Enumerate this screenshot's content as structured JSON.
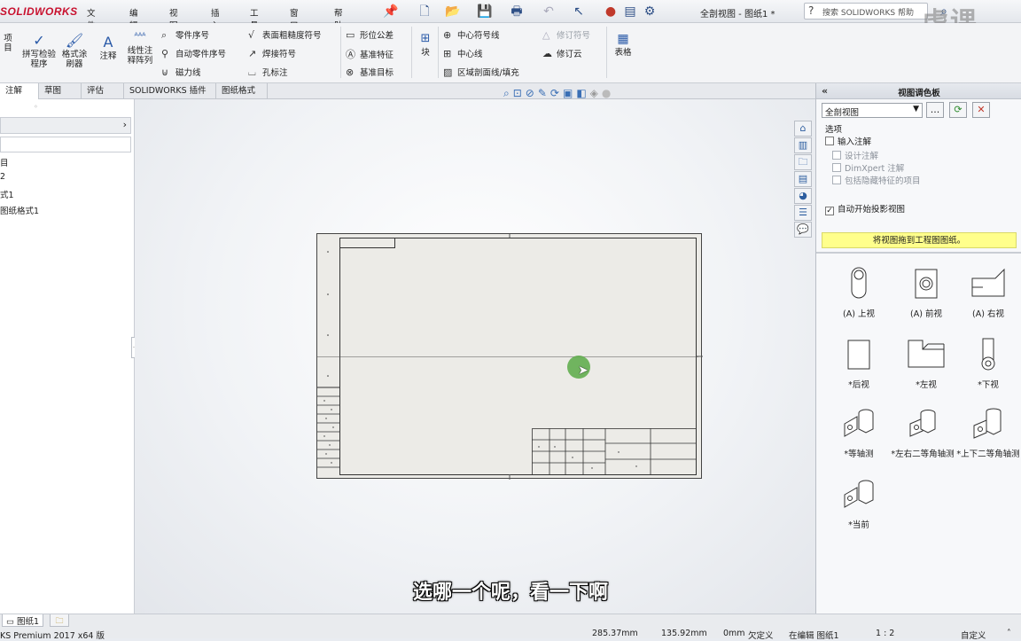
{
  "app": {
    "logo": "SOLIDWORKS",
    "menu": [
      "文件(F)",
      "编辑(E)",
      "视图(V)",
      "插入(I)",
      "工具(T)",
      "窗口(W)",
      "帮助(H)"
    ],
    "document_title": "全剖视图 - 图纸1 *",
    "search_placeholder": "搜索 SOLIDWORKS 帮助",
    "watermark": "虎课"
  },
  "ribbon": {
    "left_cut_label": "项目",
    "spellcheck": "拼写检验程序",
    "format_painter": "格式涂刷器",
    "note": "注释",
    "linear_note": "线性注释阵列",
    "balloon": "零件序号",
    "auto_balloon": "自动零件序号",
    "magnetic_line": "磁力线",
    "surface_finish": "表面粗糙度符号",
    "weld_symbol": "焊接符号",
    "hole_callout": "孔标注",
    "geometric_tolerance": "形位公差",
    "datum_feature": "基准特征",
    "datum_target": "基准目标",
    "block": "块",
    "centermark": "中心符号线",
    "centerline": "中心线",
    "area_hatch": "区域剖面线/填充",
    "revision_symbol": "修订符号",
    "revision_cloud": "修订云",
    "table": "表格"
  },
  "tabs": [
    "注解",
    "草图",
    "评估",
    "SOLIDWORKS 插件",
    "图纸格式"
  ],
  "feature_tree": {
    "items": [
      "目",
      "2",
      "式1",
      "图纸格式1"
    ]
  },
  "canvas": {
    "subtitle": "选哪一个呢，看一下啊"
  },
  "view_palette": {
    "title": "视图调色板",
    "selected_model": "全剖视图",
    "browse_label": "...",
    "options_label": "选项",
    "import_annotations": "输入注解",
    "design_annotations": "设计注解",
    "dimxpert_annotations": "DimXpert 注解",
    "hidden_features": "包括隐藏特征的项目",
    "auto_projected": "自动开始投影视图",
    "hint": "将视图拖到工程图图纸。",
    "views": [
      "(A) 上视",
      "(A) 前视",
      "(A) 右视",
      "*后视",
      "*左视",
      "*下视",
      "*等轴测",
      "*左右二等角轴测",
      "*上下二等角轴测",
      "*当前"
    ]
  },
  "status": {
    "sheet_tab": "图纸1",
    "product": "KS Premium 2017 x64 版",
    "x": "285.37mm",
    "y": "135.92mm",
    "z": "0mm",
    "state": "欠定义",
    "editing": "在编辑 图纸1",
    "scale": "1 : 2",
    "units": "自定义"
  },
  "colors": {
    "accent": "#2a5aa8",
    "logo": "#c8102e",
    "hint_bg": "#ffff8c",
    "cursor_dot": "#5aaa46"
  }
}
